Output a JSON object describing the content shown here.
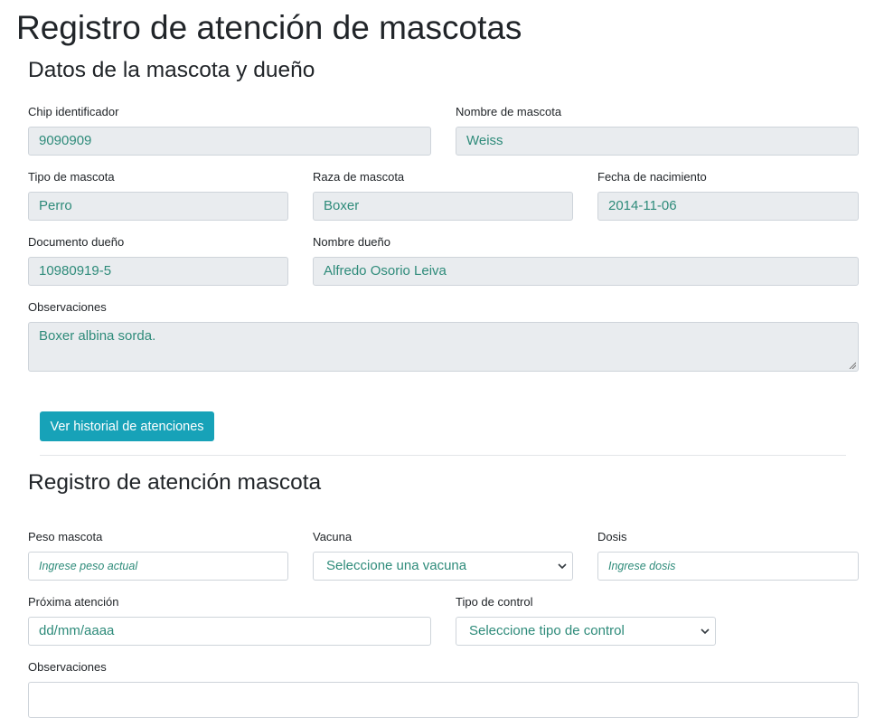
{
  "page": {
    "title": "Registro de atención de mascotas"
  },
  "pet_section": {
    "title": "Datos de la mascota y dueño",
    "chip": {
      "label": "Chip identificador",
      "value": "9090909"
    },
    "pet_name": {
      "label": "Nombre de mascota",
      "value": "Weiss"
    },
    "pet_type": {
      "label": "Tipo de mascota",
      "value": "Perro"
    },
    "breed": {
      "label": "Raza de mascota",
      "value": "Boxer"
    },
    "birth_date": {
      "label": "Fecha de nacimiento",
      "value": "2014-11-06"
    },
    "owner_doc": {
      "label": "Documento dueño",
      "value": "10980919-5"
    },
    "owner_name": {
      "label": "Nombre dueño",
      "value": "Alfredo Osorio Leiva"
    },
    "notes": {
      "label": "Observaciones",
      "value": "Boxer albina sorda."
    },
    "history_button": "Ver historial de atenciones"
  },
  "care_section": {
    "title": "Registro de atención mascota",
    "weight": {
      "label": "Peso mascota",
      "placeholder": "Ingrese peso actual"
    },
    "vaccine": {
      "label": "Vacuna",
      "selected": "Seleccione una vacuna"
    },
    "dose": {
      "label": "Dosis",
      "placeholder": "Ingrese dosis"
    },
    "next_visit": {
      "label": "Próxima atención",
      "value": "dd/mm/aaaa"
    },
    "control_type": {
      "label": "Tipo de control",
      "selected": "Seleccione tipo de control"
    },
    "notes": {
      "label": "Observaciones"
    }
  },
  "colors": {
    "accent": "#17a2b8",
    "value_text": "#2e8b7a",
    "readonly_bg": "#e9ecef",
    "border": "#ced4da"
  },
  "icons": {
    "select_arrow": "chevron-down-icon"
  }
}
